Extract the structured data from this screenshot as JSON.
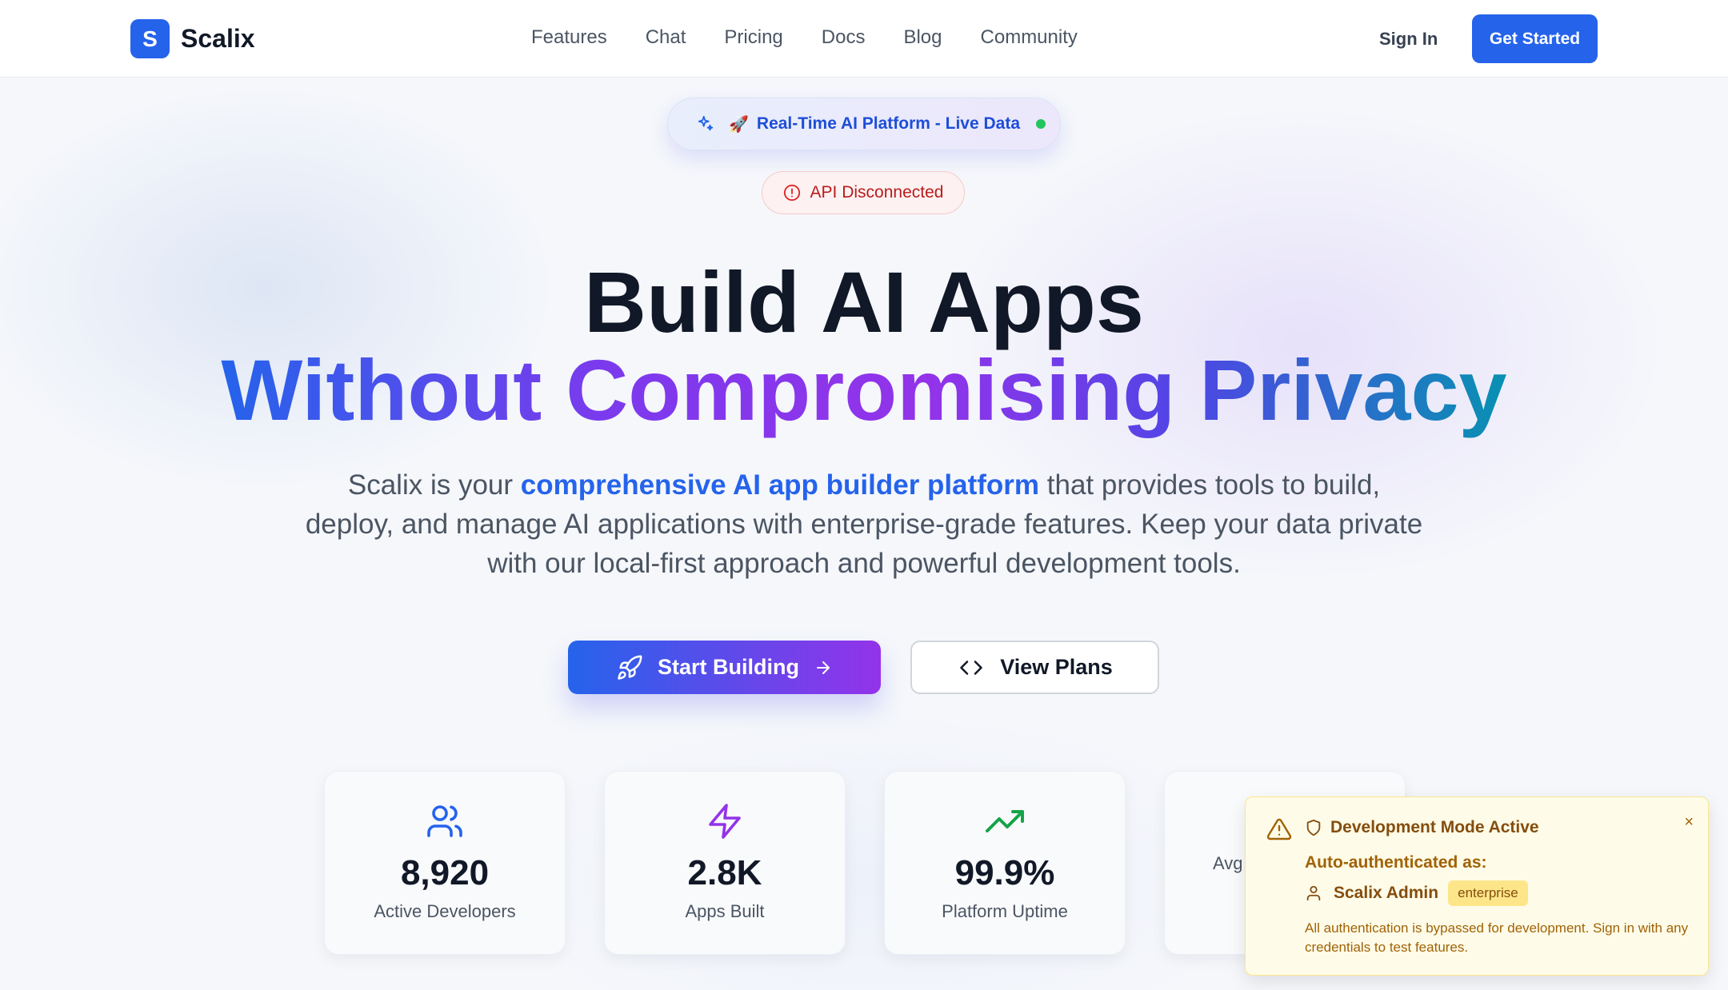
{
  "brand": {
    "mark": "S",
    "name": "Scalix",
    "accent": "#2563eb"
  },
  "nav": {
    "items": [
      "Features",
      "Chat",
      "Pricing",
      "Docs",
      "Blog",
      "Community"
    ]
  },
  "header": {
    "sign_in": "Sign In",
    "get_started": "Get Started"
  },
  "badges": {
    "live": "Real-Time AI Platform - Live Data",
    "live_status_color": "#22c55e",
    "api": "API Disconnected"
  },
  "hero": {
    "title_line1": "Build AI Apps",
    "title_line2": "Without Compromising Privacy",
    "lead_pre": "Scalix is your ",
    "lead_highlight": "comprehensive AI app builder platform",
    "lead_post": " that provides tools to build, deploy, and manage AI applications with enterprise-grade features. Keep your data private with our local-first approach and powerful development tools.",
    "primary_cta": "Start Building",
    "secondary_cta": "View Plans"
  },
  "stats": [
    {
      "icon": "users-icon",
      "value": "8,920",
      "label": "Active Developers"
    },
    {
      "icon": "bolt-icon",
      "value": "2.8K",
      "label": "Apps Built"
    },
    {
      "icon": "trending-up-icon",
      "value": "99.9%",
      "label": "Platform Uptime"
    },
    {
      "icon": "",
      "value": "",
      "label": "Avg"
    }
  ],
  "dev_toast": {
    "title": "Development Mode Active",
    "auth_label": "Auto-authenticated as:",
    "user": "Scalix Admin",
    "tier": "enterprise",
    "note": "All authentication is bypassed for development. Sign in with any credentials to test features.",
    "close": "×"
  }
}
